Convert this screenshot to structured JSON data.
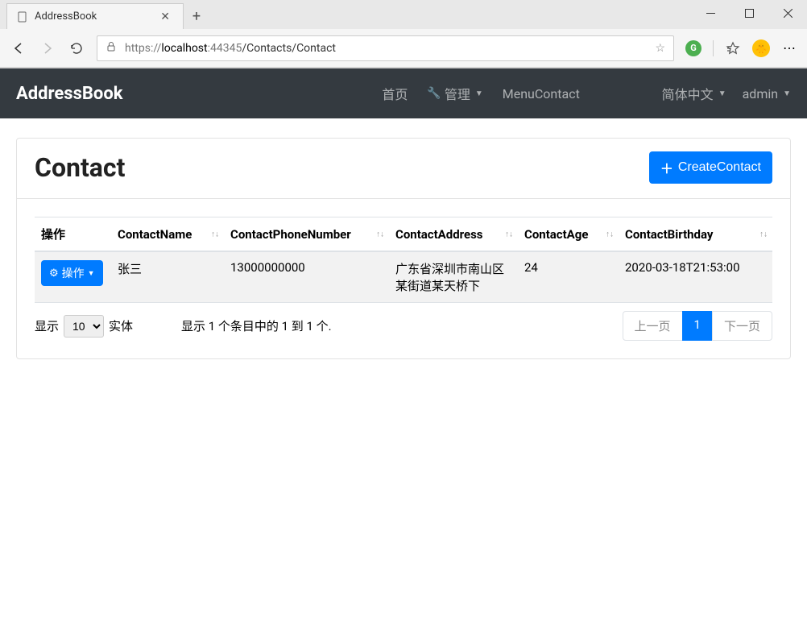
{
  "browser": {
    "tab_title": "AddressBook",
    "url_prefix": "https://",
    "url_host": "localhost",
    "url_port": ":44345",
    "url_path": "/Contacts/Contact"
  },
  "navbar": {
    "brand": "AddressBook",
    "home": "首页",
    "manage": "管理",
    "menu_contact": "MenuContact",
    "language": "简体中文",
    "user": "admin"
  },
  "page": {
    "title": "Contact",
    "create_button": "CreateContact"
  },
  "table": {
    "headers": {
      "actions": "操作",
      "name": "ContactName",
      "phone": "ContactPhoneNumber",
      "address": "ContactAddress",
      "age": "ContactAge",
      "birthday": "ContactBirthday"
    },
    "action_button": "操作",
    "rows": [
      {
        "name": "张三",
        "phone": "13000000000",
        "address": "广东省深圳市南山区某街道某天桥下",
        "age": "24",
        "birthday": "2020-03-18T21:53:00"
      }
    ]
  },
  "footer": {
    "show_prefix": "显示",
    "show_suffix": "实体",
    "page_size": "10",
    "info": "显示 1 个条目中的 1 到 1 个.",
    "prev": "上一页",
    "page_num": "1",
    "next": "下一页"
  }
}
